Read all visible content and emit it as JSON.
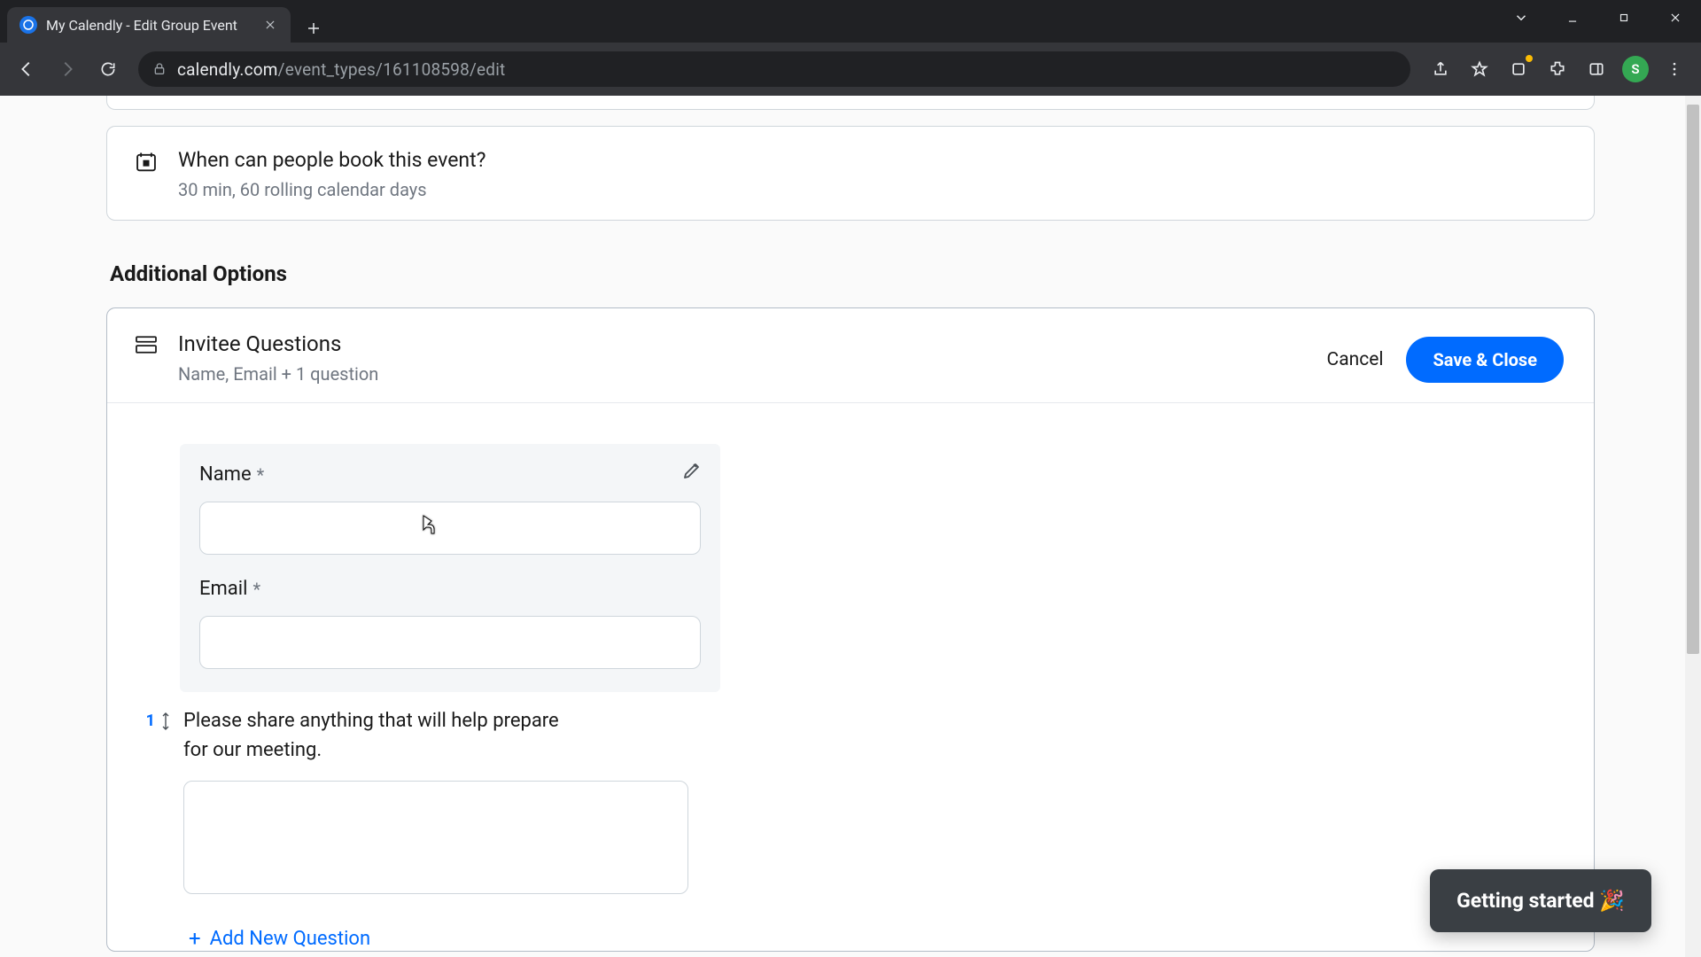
{
  "browser": {
    "tab_title": "My Calendly - Edit Group Event",
    "url_host": "calendly.com",
    "url_path": "/event_types/161108598/edit",
    "avatar_initial": "S"
  },
  "sched_card": {
    "title": "When can people book this event?",
    "subtitle": "30 min, 60 rolling calendar days"
  },
  "section_heading": "Additional Options",
  "invitee": {
    "title": "Invitee Questions",
    "subtitle": "Name, Email + 1 question",
    "cancel": "Cancel",
    "save": "Save & Close"
  },
  "fields": {
    "name_label": "Name",
    "name_req": "*",
    "email_label": "Email",
    "email_req": "*"
  },
  "custom_question": {
    "index": "1",
    "prompt": "Please share anything that will help prepare for our meeting."
  },
  "add_new_label": "Add New Question",
  "help_pill": "Getting started 🎉"
}
